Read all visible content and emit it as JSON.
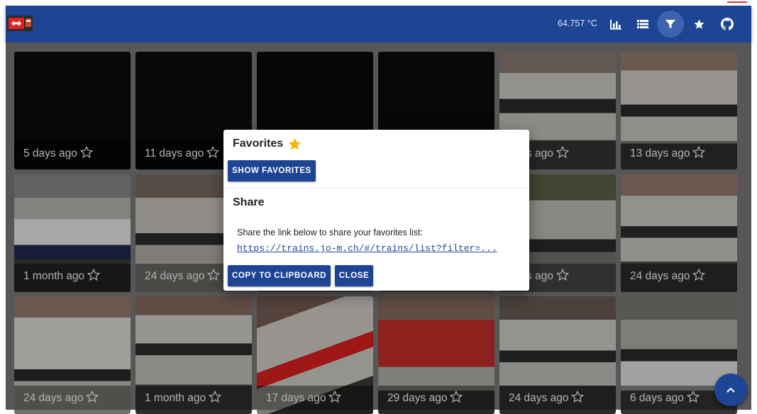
{
  "header": {
    "temperature": "64.757 °C",
    "icons": [
      "chart-icon",
      "list-icon",
      "filter-icon",
      "star-icon",
      "github-icon"
    ]
  },
  "tiles": [
    {
      "label": "5 days ago"
    },
    {
      "label": "11 days ago"
    },
    {
      "label": ""
    },
    {
      "label": ""
    },
    {
      "label": "days ago"
    },
    {
      "label": "13 days ago"
    },
    {
      "label": "1 month ago"
    },
    {
      "label": "24 days ago"
    },
    {
      "label": ""
    },
    {
      "label": ""
    },
    {
      "label": "days ago"
    },
    {
      "label": "24 days ago"
    },
    {
      "label": "24 days ago"
    },
    {
      "label": "1 month ago"
    },
    {
      "label": "17 days ago"
    },
    {
      "label": "29 days ago"
    },
    {
      "label": "24 days ago"
    },
    {
      "label": "6 days ago"
    }
  ],
  "dialog": {
    "favorites_title": "Favorites",
    "show_favorites": "SHOW FAVORITES",
    "share_title": "Share",
    "share_text": "Share the link below to share your favorites list:",
    "share_link": "https://trains.jo-m.ch/#/trains/list?filter=...",
    "copy_button": "COPY TO CLIPBOARD",
    "close_button": "CLOSE"
  },
  "colors": {
    "primary": "#1e4594",
    "favorite_star": "#f5b800"
  }
}
